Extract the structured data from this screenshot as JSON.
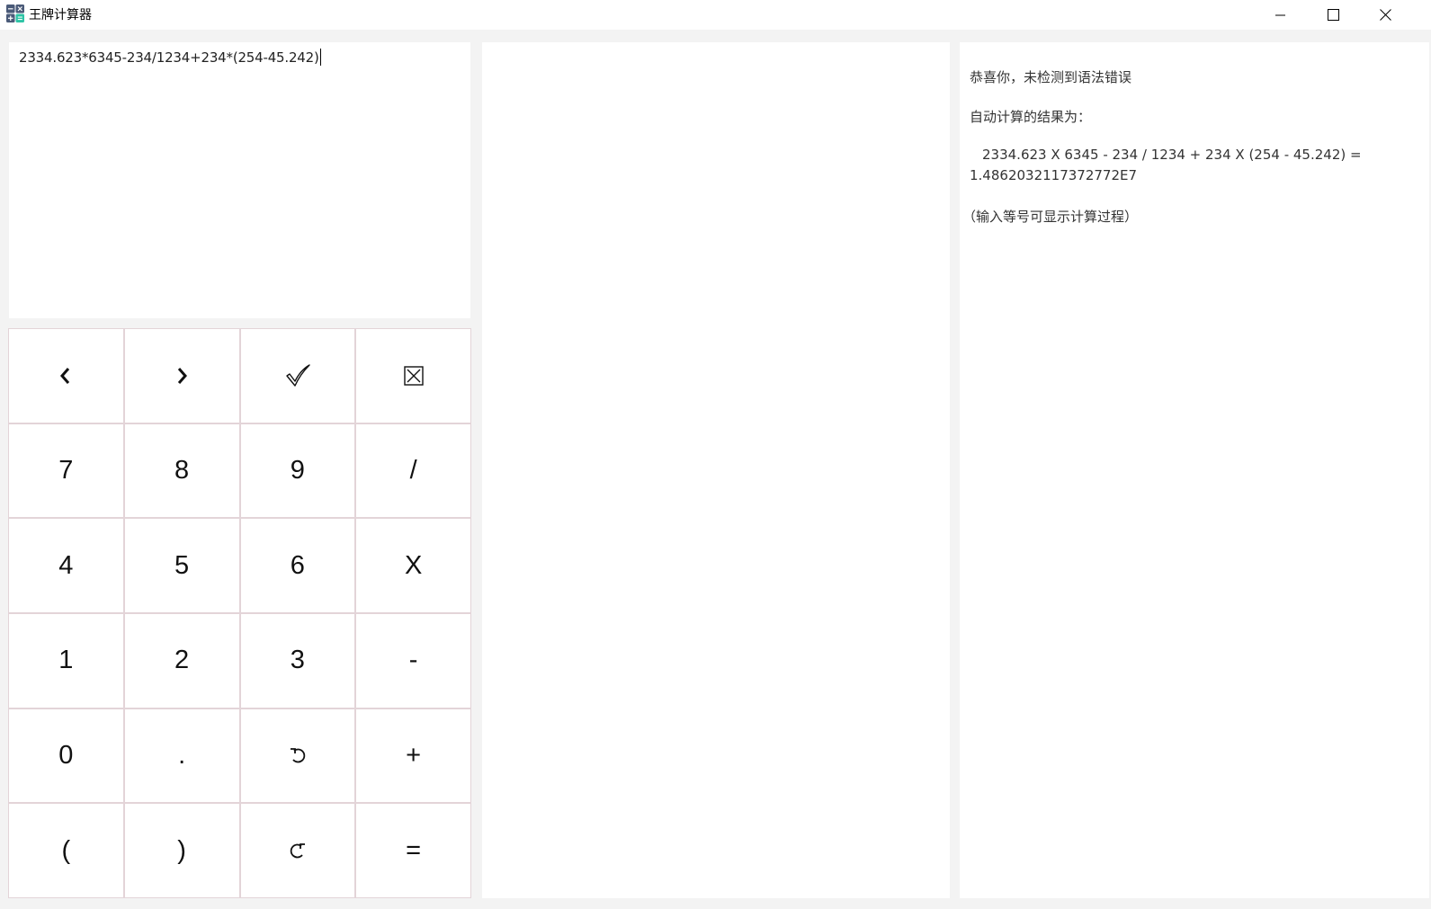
{
  "window": {
    "title": "王牌计算器",
    "controls": [
      "minimize",
      "maximize",
      "close"
    ]
  },
  "expression": {
    "value": "2334.623*6345-234/1234+234*(254-45.242)"
  },
  "keypad": {
    "keys": [
      {
        "label": "‹",
        "icon": "chevron-left-icon",
        "name": "move-left-button"
      },
      {
        "label": "›",
        "icon": "chevron-right-icon",
        "name": "move-right-button"
      },
      {
        "label": "",
        "icon": "check-icon",
        "name": "check-button"
      },
      {
        "label": "",
        "icon": "clear-box-icon",
        "name": "clear-button"
      },
      {
        "label": "7",
        "name": "key-7"
      },
      {
        "label": "8",
        "name": "key-8"
      },
      {
        "label": "9",
        "name": "key-9"
      },
      {
        "label": "/",
        "name": "key-divide"
      },
      {
        "label": "4",
        "name": "key-4"
      },
      {
        "label": "5",
        "name": "key-5"
      },
      {
        "label": "6",
        "name": "key-6"
      },
      {
        "label": "X",
        "name": "key-multiply"
      },
      {
        "label": "1",
        "name": "key-1"
      },
      {
        "label": "2",
        "name": "key-2"
      },
      {
        "label": "3",
        "name": "key-3"
      },
      {
        "label": "-",
        "name": "key-minus"
      },
      {
        "label": "0",
        "name": "key-0"
      },
      {
        "label": ".",
        "name": "key-dot"
      },
      {
        "label": "",
        "icon": "undo-icon",
        "name": "undo-button"
      },
      {
        "label": "+",
        "name": "key-plus"
      },
      {
        "label": "(",
        "name": "key-left-paren"
      },
      {
        "label": ")",
        "name": "key-right-paren"
      },
      {
        "label": "",
        "icon": "redo-icon",
        "name": "redo-button"
      },
      {
        "label": "=",
        "name": "key-equals"
      }
    ]
  },
  "result": {
    "status": "恭喜你，未检测到语法错误",
    "heading": "自动计算的结果为：",
    "equation": "2334.623 X 6345 - 234 / 1234 + 234 X (254 - 45.242) =",
    "value": "1.4862032117372772E7",
    "hint": "（输入等号可显示计算过程）"
  },
  "colors": {
    "window_bg": "#f3f3f3",
    "panel_bg": "#ffffff",
    "key_border": "#e3d4d8",
    "text": "#333333"
  }
}
